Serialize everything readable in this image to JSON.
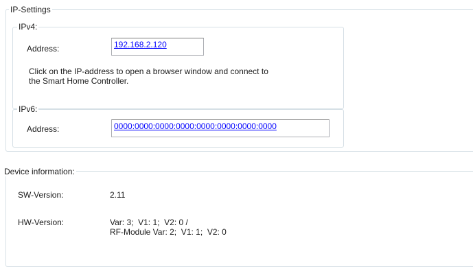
{
  "ip_settings": {
    "title": "IP-Settings",
    "ipv4": {
      "title": "IPv4:",
      "address_label": "Address:",
      "address_value": "192.168.2.120",
      "hint_line1": "Click on the IP-address to open a browser window and connect to",
      "hint_line2": "the Smart Home Controller."
    },
    "ipv6": {
      "title": "IPv6:",
      "address_label": "Address:",
      "address_value": "0000:0000:0000:0000:0000:0000:0000:0000"
    }
  },
  "device_info": {
    "title": "Device information:",
    "sw_label": "SW-Version:",
    "sw_value": "2.11",
    "hw_label": "HW-Version:",
    "hw_line1": "Var: 3;  V1: 1;  V2: 0 /",
    "hw_line2": "RF-Module Var: 2;  V1: 1;  V2: 0"
  },
  "colors": {
    "group_border": "#d5dfe5",
    "link": "#0000ff"
  }
}
